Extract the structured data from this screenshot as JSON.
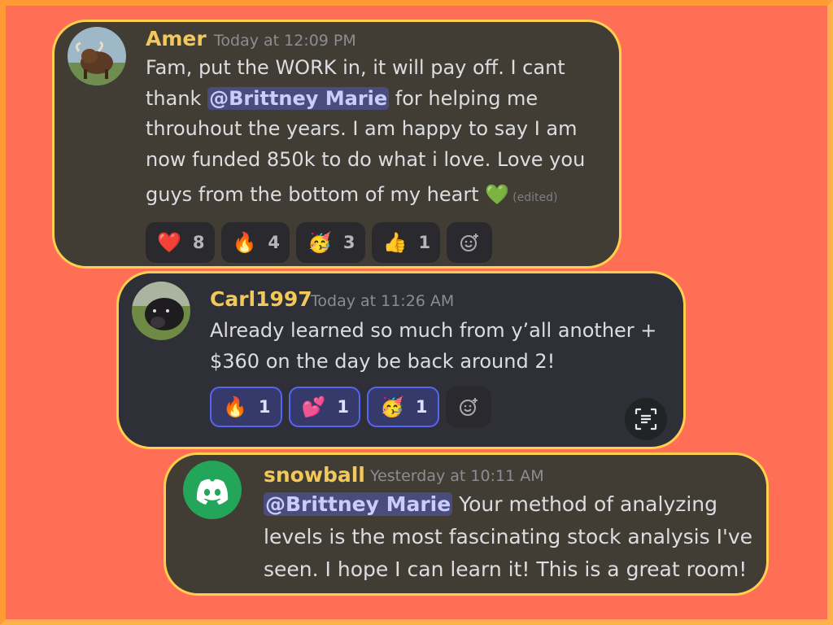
{
  "messages": [
    {
      "author": "Amer",
      "timestamp": "Today at 12:09 PM",
      "lines": [
        "Fam, put the WORK in, it will pay off. I cant",
        [
          "thank ",
          "@Brittney Marie",
          " for helping me"
        ],
        "throuhout the years. I am happy to say I am",
        "now funded 850k to do what i love. Love you",
        "guys from the bottom of my heart"
      ],
      "trailing_emoji": "💚",
      "edited": "(edited)",
      "reactions": [
        {
          "emoji": "❤️",
          "count": "8"
        },
        {
          "emoji": "🔥",
          "count": "4"
        },
        {
          "emoji": "🥳",
          "count": "3"
        },
        {
          "emoji": "👍",
          "count": "1"
        }
      ],
      "add_reaction_icon": "add-emoji-icon"
    },
    {
      "author": "Carl1997",
      "timestamp": "Today at 11:26 AM",
      "lines": [
        "Already learned so much from y’all another +",
        "$360 on the day be back around 2!"
      ],
      "reactions": [
        {
          "emoji": "🔥",
          "count": "1"
        },
        {
          "emoji": "💕",
          "count": "1"
        },
        {
          "emoji": "🥳",
          "count": "1"
        }
      ],
      "add_reaction_icon": "add-emoji-icon",
      "scan_text_icon": "text-scan-icon"
    },
    {
      "author": "snowball",
      "timestamp": "Yesterday at 10:11 AM",
      "lines": [
        [
          "",
          "@Brittney Marie",
          " Your method of analyzing"
        ],
        "levels is the most fascinating stock analysis I've",
        "seen. I hope I can learn it! This is a great room!"
      ]
    }
  ],
  "colors": {
    "background": "#ff6f55",
    "card_border": "#ffcf4d",
    "username": "#f2c75c",
    "mention_bg": "#4a4c7e",
    "discord_green": "#23a55a",
    "active_reaction_border": "#5865f2"
  }
}
